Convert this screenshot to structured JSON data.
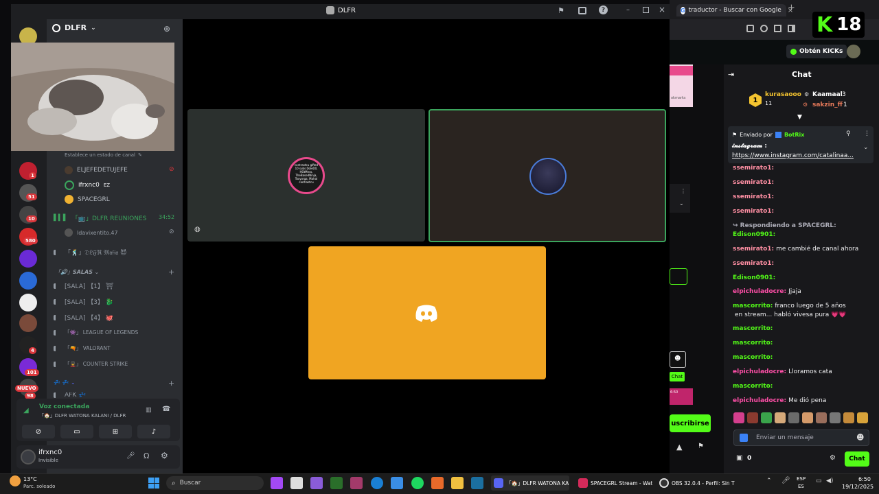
{
  "browser": {
    "tab_title": "traductor - Buscar con Google",
    "tab_new": "+"
  },
  "kick": {
    "logo": "K",
    "count": "18",
    "obtain_label": "Obtén KICKs"
  },
  "chat": {
    "title": "Chat",
    "leaders": [
      {
        "rank": "1",
        "name": "kurasaooo",
        "value": "11"
      },
      {
        "name": "Kaamaal",
        "value": "3"
      },
      {
        "name": "sakzin_ff",
        "value": "1"
      }
    ],
    "pinned": {
      "sent_by": "Enviado por",
      "bot": "BotRix",
      "text": "𝓲𝓷𝓼𝓽𝓪𝓰𝓻𝓪𝓶 :",
      "link": "https://www.instagram.com/catalinaa..."
    },
    "messages": [
      {
        "user": "ssemirato1:",
        "text": "",
        "color": "#ff8fa3"
      },
      {
        "user": "ssemirato1:",
        "text": "",
        "color": "#ff8fa3"
      },
      {
        "user": "ssemirato1:",
        "text": "",
        "color": "#ff8fa3"
      },
      {
        "user": "ssemirato1:",
        "text": "",
        "color": "#ff8fa3"
      },
      {
        "user": "↪ Respondiendo a SPACEGRL:",
        "text": "",
        "color": "#adadb8"
      },
      {
        "user": "Edison0901:",
        "text": "",
        "color": "#53fc18"
      },
      {
        "user": "ssemirato1:",
        "text": "me cambié de canal ahora",
        "color": "#ff8fa3"
      },
      {
        "user": "ssemirato1:",
        "text": "",
        "color": "#ff8fa3"
      },
      {
        "user": "Edison0901:",
        "text": "",
        "color": "#53fc18"
      },
      {
        "user": "elpichuladocre:",
        "text": "Jjaja",
        "color": "#ff4fa8"
      },
      {
        "user": "mascorrito:",
        "text": "franco luego de 5 años",
        "color": "#53fc18"
      },
      {
        "user": "",
        "text": "en stream... habló vivesa pura 💗💗",
        "color": "#efeff1"
      },
      {
        "user": "mascorrito:",
        "text": "",
        "color": "#53fc18"
      },
      {
        "user": "mascorrito:",
        "text": "",
        "color": "#53fc18"
      },
      {
        "user": "mascorrito:",
        "text": "",
        "color": "#53fc18"
      },
      {
        "user": "elpichuladocre:",
        "text": "Lloramos cata",
        "color": "#ff4fa8"
      },
      {
        "user": "mascorrito:",
        "text": "",
        "color": "#53fc18"
      },
      {
        "user": "elpichuladocre:",
        "text": "Me dió pena",
        "color": "#ff4fa8"
      }
    ],
    "input_placeholder": "Enviar un mensaje",
    "viewers": "0",
    "send_label": "Chat",
    "subscribe_label": "uscribirse",
    "side_chat_label": "Chat"
  },
  "discord": {
    "window_title": "DLFR",
    "server_name": "DLFR",
    "status_placeholder": "Establece un estado de canal",
    "voice_members": [
      {
        "name": "ELJEFEDETUJEFE"
      },
      {
        "name": "ifrxnc0",
        "tag": "EZ"
      },
      {
        "name": "SPACEGRL"
      }
    ],
    "meeting_channel": "「📺」DLFR REUNIONES",
    "meeting_time": "34:52",
    "meeting_member": "ldavixentito.47",
    "mafia_channel": "「🕺」𝔇𝔏𝔉ℜ 𝔐𝔞𝔣𝔦𝔞 😈",
    "salas_category": "「🔊」𝙎𝘼𝙇𝘼𝙎",
    "salas": [
      {
        "label": "[SALA] 【1】 ⛩"
      },
      {
        "label": "[SALA] 【3】 🐉"
      },
      {
        "label": "[SALA] 【4】 🐙"
      },
      {
        "label": "「👾」 LEAGUE OF LEGENDS"
      },
      {
        "label": "「🔫」 VALORANT"
      },
      {
        "label": "「💂」 COUNTER STRIKE"
      }
    ],
    "afk_category": "💤 💤",
    "afk_channel": "AFK 💤",
    "voice_connected": "Voz conectada",
    "voice_channel": "「🏠」DLFR WATONA KALANI / DLFR",
    "user_name": "ifrxnc0",
    "user_status": "Invisible",
    "tile_text": "contrastcu gifted 10 subs DoleD0, HOtMess, TheBasedNinja, Toxyorga, Mahal contrastcu",
    "guild_badges": [
      "1",
      "51",
      "10",
      "580",
      "4",
      "101",
      "NUEVO",
      "98"
    ]
  },
  "taskbar": {
    "weather_temp": "13°C",
    "weather_desc": "Parc. soleado",
    "search": "Buscar",
    "items": [
      "「🏠」DLFR WATONA KA",
      "SPACEGRL Stream - Wat",
      "OBS 32.0.4 - Perfil: Sin T"
    ],
    "lang1": "ESP",
    "lang2": "ES",
    "time": "6:50",
    "date": "19/12/2025"
  },
  "colors": {
    "kick_green": "#53fc18",
    "discord_blurple": "#5865f2",
    "tile_orange": "#f0a522",
    "tile_dark": "#2b302e",
    "tile_brown": "#2a2420",
    "speaking_green": "#3ba55d"
  }
}
